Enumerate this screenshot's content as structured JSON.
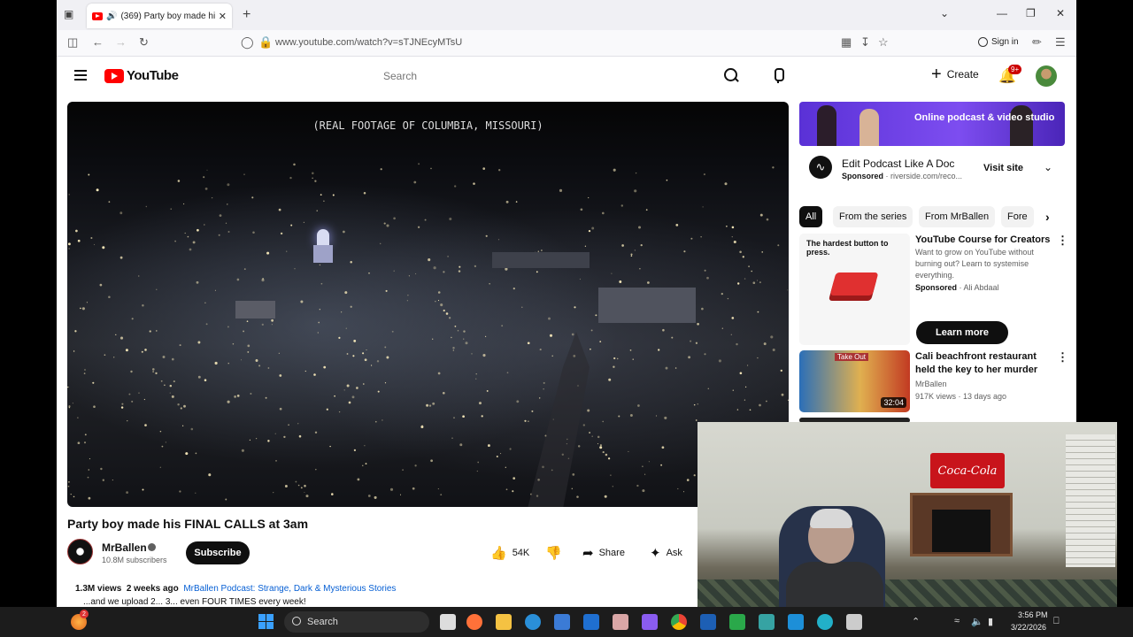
{
  "browser": {
    "tab_title": "(369) Party boy made his FI",
    "url": "www.youtube.com/watch?v=sTJNEcyMTsU",
    "signin_label": "Sign in"
  },
  "youtube": {
    "logo_text": "YouTube",
    "search_placeholder": "Search",
    "create_label": "Create",
    "notification_count": "9+"
  },
  "video": {
    "caption": "(REAL FOOTAGE OF COLUMBIA, MISSOURI)",
    "title": "Party boy made his FINAL CALLS at 3am",
    "channel": "MrBallen",
    "subscribers": "10.8M subscribers",
    "subscribe_label": "Subscribe",
    "likes": "54K",
    "share_label": "Share",
    "ask_label": "Ask",
    "views": "1.3M views",
    "age": "2 weeks ago",
    "podcast_link": "MrBallen Podcast: Strange, Dark & Mysterious Stories",
    "desc_line2": "...and we upload 2... 3... even FOUR TIMES every week!"
  },
  "sidebar": {
    "ad_banner_text": "Online podcast & video studio",
    "sponsor": {
      "title": "Edit Podcast Like A Doc",
      "sponsored_label": "Sponsored",
      "domain": "riverside.com/reco...",
      "visit_label": "Visit site"
    },
    "chips": [
      "All",
      "From the series",
      "From MrBallen",
      "Fore"
    ],
    "cards": [
      {
        "thumb_text": "The hardest button to press.",
        "title": "YouTube Course for Creators",
        "desc": "Want to grow on YouTube without burning out? Learn to systemise everything.",
        "sponsored_label": "Sponsored",
        "author": "Ali Abdaal",
        "cta": "Learn more"
      },
      {
        "thumb_text": "Take Out",
        "title": "Cali beachfront restaurant held the key to her murder",
        "channel": "MrBallen",
        "meta": "917K views · 13 days ago",
        "duration": "32:04"
      }
    ]
  },
  "webcam": {
    "sign_text": "Coca-Cola"
  },
  "taskbar": {
    "search_label": "Search",
    "time": "3:56 PM",
    "date": "3/22/2026",
    "badge": "2"
  },
  "colors": {
    "youtube_red": "#ff0000",
    "ad_purple": "#6b3ee6",
    "taskbar": "#1c1c1c"
  }
}
